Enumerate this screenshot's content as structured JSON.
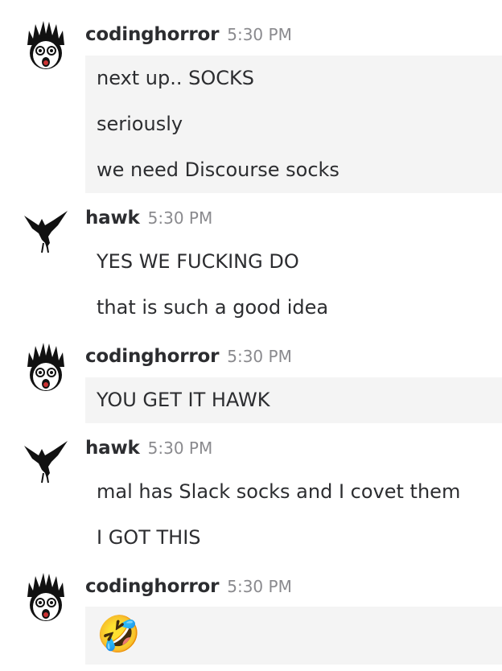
{
  "messages": [
    {
      "user": "codinghorror",
      "time": "5:30 PM",
      "avatar_icon": "codinghorror-face-icon",
      "lines": [
        "next up.. SOCKS",
        "seriously",
        "we need Discourse socks"
      ]
    },
    {
      "user": "hawk",
      "time": "5:30 PM",
      "avatar_icon": "hawk-bird-icon",
      "lines": [
        "YES WE FUCKING DO",
        "that is such a good idea"
      ]
    },
    {
      "user": "codinghorror",
      "time": "5:30 PM",
      "avatar_icon": "codinghorror-face-icon",
      "lines": [
        "YOU GET IT HAWK"
      ]
    },
    {
      "user": "hawk",
      "time": "5:30 PM",
      "avatar_icon": "hawk-bird-icon",
      "lines": [
        "mal has Slack socks and I covet them",
        "I GOT THIS"
      ]
    },
    {
      "user": "codinghorror",
      "time": "5:30 PM",
      "avatar_icon": "codinghorror-face-icon",
      "lines": [
        "🤣"
      ]
    }
  ],
  "colors": {
    "highlight_bg": "#f4f4f4",
    "text": "#2c2d30",
    "timestamp": "#8a8a8e"
  }
}
